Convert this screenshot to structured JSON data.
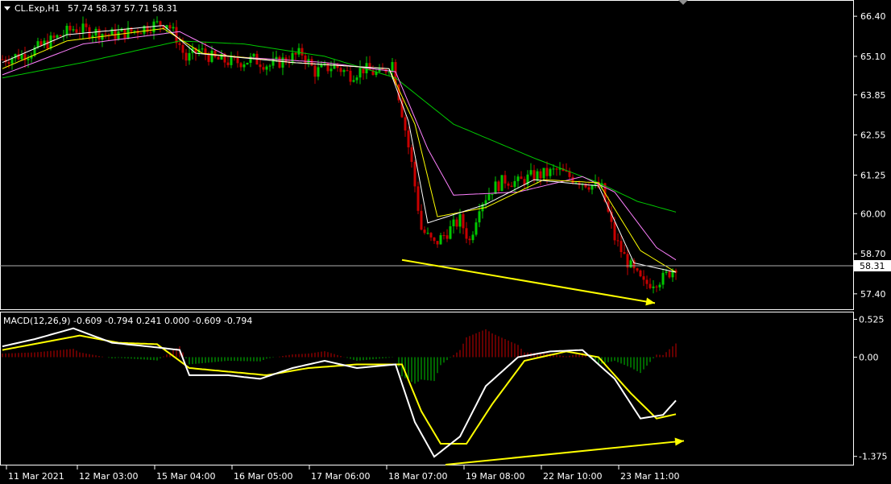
{
  "header": {
    "symbol_label": "CL.Exp,H1",
    "ohlc": "57.74 58.37 57.71 58.31"
  },
  "macd_header": "MACD(12,26,9) -0.609 -0.794 0.241 0.000 -0.609 -0.794",
  "colors": {
    "background": "#000000",
    "bull": "#00c800",
    "bear": "#c80000",
    "ma_fast": "#ffffff",
    "ma_mid": "#ffff00",
    "ma_slow": "#ff80ff",
    "ma_long": "#00c800",
    "macd_line": "#ffffff",
    "signal_line": "#ffff00",
    "annotation": "#ffff00",
    "price_line": "#b0b0b0",
    "axis": "#ffffff"
  },
  "chart_data": [
    {
      "type": "candlestick",
      "title": "CL.Exp,H1",
      "current_price": "58.31",
      "ylim": [
        56.9,
        66.9
      ],
      "y_ticks": [
        "66.40",
        "65.10",
        "63.85",
        "62.55",
        "61.25",
        "60.00",
        "58.70",
        "57.40"
      ],
      "y_tick_values": [
        66.4,
        65.1,
        63.85,
        62.55,
        61.25,
        60.0,
        58.7,
        57.4
      ],
      "x_ticks": [
        "11 Mar 2021",
        "12 Mar 03:00",
        "15 Mar 04:00",
        "16 Mar 05:00",
        "17 Mar 06:00",
        "18 Mar 07:00",
        "19 Mar 08:00",
        "22 Mar 10:00",
        "23 Mar 11:00"
      ],
      "close_path_anchors": [
        [
          0,
          65.0
        ],
        [
          8,
          65.2
        ],
        [
          15,
          65.6
        ],
        [
          22,
          66.0
        ],
        [
          28,
          65.9
        ],
        [
          34,
          65.8
        ],
        [
          40,
          65.9
        ],
        [
          46,
          66.1
        ],
        [
          51,
          66.2
        ],
        [
          54,
          65.7
        ],
        [
          57,
          65.0
        ],
        [
          61,
          65.3
        ],
        [
          66,
          65.0
        ],
        [
          72,
          64.9
        ],
        [
          78,
          65.0
        ],
        [
          83,
          64.8
        ],
        [
          88,
          65.0
        ],
        [
          93,
          65.2
        ],
        [
          97,
          64.6
        ],
        [
          103,
          64.8
        ],
        [
          108,
          64.5
        ],
        [
          112,
          64.7
        ],
        [
          117,
          64.5
        ],
        [
          121,
          64.9
        ],
        [
          124,
          63.3
        ],
        [
          127,
          61.6
        ],
        [
          130,
          59.5
        ],
        [
          134,
          59.0
        ],
        [
          138,
          59.4
        ],
        [
          142,
          59.8
        ],
        [
          145,
          59.1
        ],
        [
          148,
          60.3
        ],
        [
          152,
          60.8
        ],
        [
          156,
          61.1
        ],
        [
          160,
          61.0
        ],
        [
          164,
          61.2
        ],
        [
          169,
          61.3
        ],
        [
          172,
          61.4
        ],
        [
          176,
          61.2
        ],
        [
          181,
          61.0
        ],
        [
          186,
          60.8
        ],
        [
          190,
          59.2
        ],
        [
          193,
          58.6
        ],
        [
          196,
          58.1
        ],
        [
          199,
          57.7
        ],
        [
          202,
          57.8
        ],
        [
          205,
          57.9
        ],
        [
          209,
          58.31
        ]
      ],
      "ma_fast_anchors": [
        [
          0,
          64.9
        ],
        [
          20,
          65.8
        ],
        [
          50,
          66.1
        ],
        [
          60,
          65.2
        ],
        [
          90,
          64.9
        ],
        [
          120,
          64.7
        ],
        [
          126,
          63.0
        ],
        [
          132,
          59.7
        ],
        [
          150,
          60.3
        ],
        [
          165,
          61.1
        ],
        [
          185,
          60.9
        ],
        [
          196,
          58.4
        ],
        [
          209,
          58.1
        ]
      ],
      "ma_mid_anchors": [
        [
          0,
          64.7
        ],
        [
          20,
          65.6
        ],
        [
          50,
          66.0
        ],
        [
          62,
          65.2
        ],
        [
          90,
          64.9
        ],
        [
          120,
          64.7
        ],
        [
          128,
          62.9
        ],
        [
          135,
          59.9
        ],
        [
          150,
          60.2
        ],
        [
          168,
          61.1
        ],
        [
          185,
          61.0
        ],
        [
          198,
          58.8
        ],
        [
          209,
          58.1
        ]
      ],
      "ma_slow_anchors": [
        [
          0,
          64.5
        ],
        [
          25,
          65.5
        ],
        [
          55,
          65.9
        ],
        [
          70,
          65.1
        ],
        [
          100,
          64.9
        ],
        [
          122,
          64.6
        ],
        [
          132,
          62.1
        ],
        [
          140,
          60.6
        ],
        [
          160,
          60.7
        ],
        [
          180,
          61.2
        ],
        [
          190,
          60.7
        ],
        [
          203,
          58.9
        ],
        [
          209,
          58.5
        ]
      ],
      "ma_long_anchors": [
        [
          0,
          64.4
        ],
        [
          25,
          64.9
        ],
        [
          55,
          65.6
        ],
        [
          75,
          65.5
        ],
        [
          100,
          65.1
        ],
        [
          122,
          64.4
        ],
        [
          140,
          62.9
        ],
        [
          165,
          61.8
        ],
        [
          185,
          61.0
        ],
        [
          197,
          60.4
        ],
        [
          209,
          60.05
        ]
      ],
      "annotation": {
        "from": [
          129,
          58.5
        ],
        "to": [
          200,
          57.1
        ],
        "label": ""
      }
    },
    {
      "type": "macd",
      "title": "MACD(12,26,9) -0.609 -0.794 0.241 0.000 -0.609 -0.794",
      "ylim": [
        -1.49,
        0.62
      ],
      "y_ticks": [
        "0.525",
        "0.00",
        "-1.375"
      ],
      "y_tick_values": [
        0.525,
        0.0,
        -1.375
      ],
      "macd_anchors": [
        [
          0,
          0.15
        ],
        [
          10,
          0.25
        ],
        [
          22,
          0.4
        ],
        [
          34,
          0.2
        ],
        [
          45,
          0.15
        ],
        [
          55,
          0.1
        ],
        [
          58,
          -0.25
        ],
        [
          70,
          -0.25
        ],
        [
          80,
          -0.3
        ],
        [
          90,
          -0.15
        ],
        [
          100,
          -0.05
        ],
        [
          110,
          -0.15
        ],
        [
          122,
          -0.1
        ],
        [
          128,
          -0.9
        ],
        [
          134,
          -1.38
        ],
        [
          142,
          -1.1
        ],
        [
          150,
          -0.4
        ],
        [
          160,
          0.0
        ],
        [
          170,
          0.08
        ],
        [
          180,
          0.1
        ],
        [
          190,
          -0.3
        ],
        [
          198,
          -0.85
        ],
        [
          205,
          -0.8
        ],
        [
          209,
          -0.6
        ]
      ],
      "signal_anchors": [
        [
          0,
          0.1
        ],
        [
          12,
          0.2
        ],
        [
          24,
          0.3
        ],
        [
          36,
          0.2
        ],
        [
          48,
          0.18
        ],
        [
          58,
          -0.15
        ],
        [
          70,
          -0.2
        ],
        [
          82,
          -0.25
        ],
        [
          95,
          -0.15
        ],
        [
          110,
          -0.1
        ],
        [
          124,
          -0.1
        ],
        [
          130,
          -0.75
        ],
        [
          136,
          -1.2
        ],
        [
          144,
          -1.2
        ],
        [
          152,
          -0.65
        ],
        [
          162,
          -0.05
        ],
        [
          175,
          0.08
        ],
        [
          185,
          0.0
        ],
        [
          195,
          -0.5
        ],
        [
          203,
          -0.85
        ],
        [
          209,
          -0.79
        ]
      ],
      "annotation": {
        "from": [
          130,
          -1.49
        ],
        "to": [
          209,
          -1.16
        ],
        "label": ""
      }
    }
  ]
}
